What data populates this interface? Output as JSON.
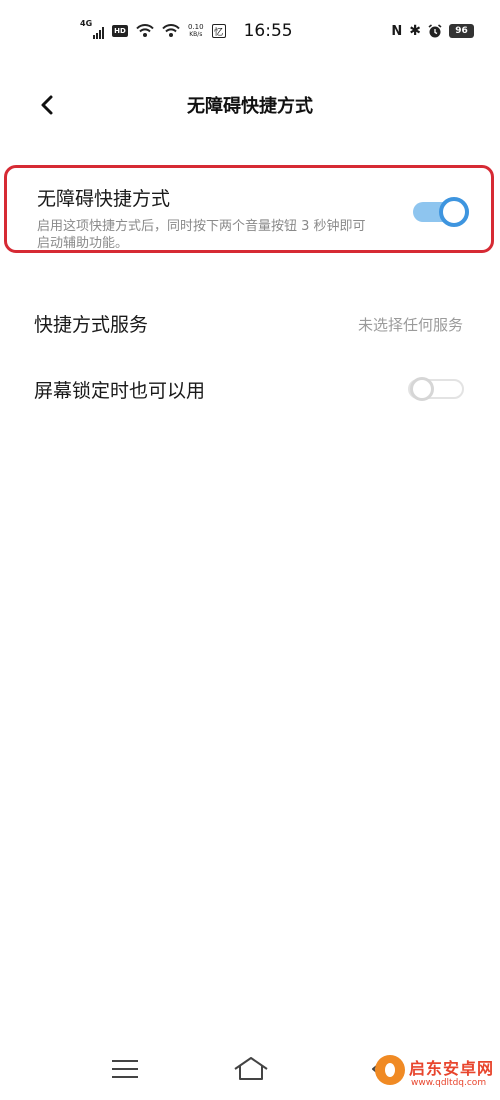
{
  "status_bar": {
    "network": "4G",
    "hd": "HD",
    "speed_value": "0.10",
    "speed_unit": "KB/s",
    "yi": "忆",
    "time": "16:55",
    "nfc": "N",
    "bluetooth": "✱",
    "battery": "96"
  },
  "header": {
    "title": "无障碍快捷方式"
  },
  "shortcut": {
    "title": "无障碍快捷方式",
    "description": "启用这项快捷方式后，同时按下两个音量按钮 3 秒钟即可启动辅助功能。",
    "enabled": true
  },
  "service": {
    "label": "快捷方式服务",
    "value": "未选择任何服务"
  },
  "lock_screen": {
    "label": "屏幕锁定时也可以用",
    "enabled": false
  },
  "colors": {
    "toggle_on": "#3e95df",
    "highlight_border": "#d62a34"
  },
  "watermark": {
    "name": "启东安卓网",
    "url": "www.qdltdq.com"
  }
}
